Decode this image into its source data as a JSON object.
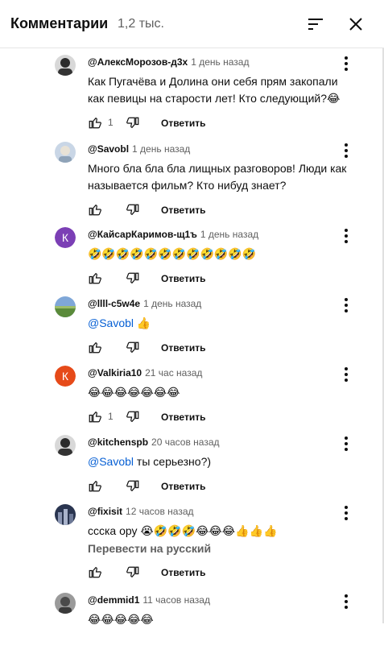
{
  "header": {
    "title": "Комментарии",
    "count": "1,2 тыс."
  },
  "reply_label": "Ответить",
  "translate_label": "Перевести на русский",
  "comments": [
    {
      "author": "@АлексМорозов-д3х",
      "time": "1 день назад",
      "lines": [
        "Как Пугачёва и Долина они себя прям закопали",
        "как певицы на старости лет! Кто следующий?😂"
      ],
      "likes": "1",
      "avatar": "photo-dark"
    },
    {
      "author": "@Savobl",
      "time": "1 день назад",
      "lines": [
        "Много бла бла бла лищных разговоров! Люди как",
        "называется фильм? Кто нибуд знает?"
      ],
      "likes": "",
      "avatar": "photo-light"
    },
    {
      "author": "@КайсарКаримов-щ1ъ",
      "time": "1 день назад",
      "lines": [
        "🤣🤣🤣🤣🤣🤣🤣🤣🤣🤣🤣🤣"
      ],
      "likes": "",
      "avatar": "letter",
      "letter": "К",
      "color": "#7b3fb5"
    },
    {
      "author": "@llll-c5w4e",
      "time": "1 день назад",
      "mention": "@Savobl",
      "after": " 👍",
      "likes": "",
      "avatar": "photo-landscape"
    },
    {
      "author": "@Valkiria10",
      "time": "21 час назад",
      "lines": [
        "😂😂😂😂😂😂😂"
      ],
      "likes": "1",
      "avatar": "letter",
      "letter": "К",
      "color": "#e64a19"
    },
    {
      "author": "@kitchenspb",
      "time": "20 часов назад",
      "mention": "@Savobl",
      "after": " ты серьезно?)",
      "likes": "",
      "avatar": "photo-dark"
    },
    {
      "author": "@fixisit",
      "time": "12 часов назад",
      "lines": [
        "ссска ору 😭🤣🤣🤣😂😂😂👍👍👍"
      ],
      "likes": "",
      "avatar": "photo-city",
      "translate": true
    },
    {
      "author": "@demmid1",
      "time": "11 часов назад",
      "lines": [
        "😂😂😂😂😂"
      ],
      "likes": "",
      "avatar": "photo-gray"
    }
  ]
}
